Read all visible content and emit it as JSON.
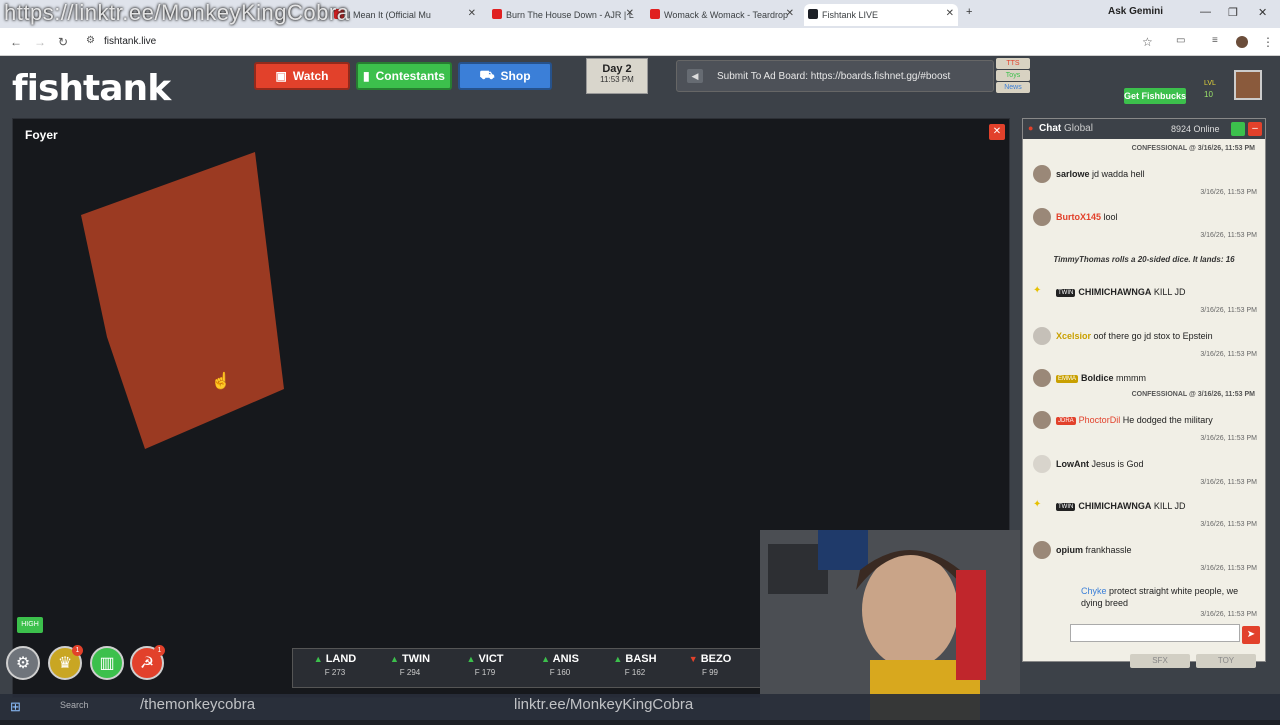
{
  "browser": {
    "watermark": "https://linktr.ee/MonkeyKingCobra",
    "tabs": [
      {
        "label": "I Mean It (Official Mu",
        "active": false
      },
      {
        "label": "Burn The House Down - AJR | L",
        "active": false
      },
      {
        "label": "Womack & Womack - Teardrop",
        "active": false
      },
      {
        "label": "Fishtank LIVE",
        "active": true
      }
    ],
    "ask_gemini": "Ask Gemini",
    "url": "fishtank.live"
  },
  "site": {
    "logo": "fishtank",
    "nav": {
      "watch": "Watch",
      "contestants": "Contestants",
      "shop": "Shop"
    },
    "day": {
      "label": "Day 2",
      "time": "11:53 PM"
    },
    "adboard": "Submit To Ad Board: https://boards.fishnet.gg/#boost",
    "side_tags": [
      "TTS",
      "Toys",
      "News"
    ],
    "user": {
      "fishbucks_label": "Get Fishbucks",
      "lvl": "LVL",
      "coins": "10"
    }
  },
  "video": {
    "room": "Foyer",
    "quality": "HIGH",
    "colors": {
      "block": "#9b3a22"
    }
  },
  "bottom": {
    "notification_badges": [
      "1",
      "1"
    ],
    "ticker": [
      {
        "name": "LAND",
        "value": "F 273",
        "dir": "up"
      },
      {
        "name": "TWIN",
        "value": "F 294",
        "dir": "up"
      },
      {
        "name": "VICT",
        "value": "F 179",
        "dir": "up"
      },
      {
        "name": "ANIS",
        "value": "F 160",
        "dir": "up"
      },
      {
        "name": "BASH",
        "value": "F 162",
        "dir": "up"
      },
      {
        "name": "BEZO",
        "value": "F 99",
        "dir": "down"
      }
    ]
  },
  "chat": {
    "title": "Chat",
    "scope": "Global",
    "online": "8924 Online",
    "messages": [
      {
        "kind": "confessional",
        "text": "CONFESSIONAL @ 3/16/26, 11:53 PM"
      },
      {
        "kind": "msg",
        "user": "sarlowe",
        "text": "jd wadda hell",
        "ts": "3/16/26, 11:53 PM",
        "color": "#222222"
      },
      {
        "kind": "msg",
        "user": "BurtoX145",
        "text": "lool",
        "ts": "3/16/26, 11:53 PM",
        "color": "#e2412b"
      },
      {
        "kind": "sys",
        "text": "TimmyThomas rolls a 20-sided dice. It lands: 16"
      },
      {
        "kind": "msg",
        "user": "CHIMICHAWNGA",
        "tag": "TWIN",
        "text": "KILL JD",
        "ts": "3/16/26, 11:53 PM",
        "color": "#222222"
      },
      {
        "kind": "msg",
        "user": "Xcelsior",
        "text": "oof there go jd stox to Epstein",
        "ts": "3/16/26, 11:53 PM",
        "color": "#c9a000"
      },
      {
        "kind": "msg",
        "user": "Boldice",
        "tag": "EMMA",
        "text": "mmmm",
        "ts": "3/16/26, 11:53 PM",
        "color": "#222222"
      },
      {
        "kind": "confessional",
        "text": "CONFESSIONAL @ 3/16/26, 11:53 PM"
      },
      {
        "kind": "msg",
        "user": "PhoctorDil",
        "tag": "JDRA",
        "text": "He dodged the military",
        "ts": "3/16/26, 11:53 PM",
        "color": "#e2412b"
      },
      {
        "kind": "msg",
        "user": "LowAnt",
        "text": "Jesus is God",
        "ts": "3/16/26, 11:53 PM",
        "color": "#222222"
      },
      {
        "kind": "msg",
        "user": "CHIMICHAWNGA",
        "tag": "TWIN",
        "text": "KILL JD",
        "ts": "3/16/26, 11:53 PM",
        "color": "#222222"
      },
      {
        "kind": "msg",
        "user": "opium",
        "text": "frankhassle",
        "ts": "3/16/26, 11:53 PM",
        "color": "#222222"
      },
      {
        "kind": "msg",
        "user": "Chyke",
        "text": "protect straight white people, we dying breed",
        "ts": "3/16/26, 11:53 PM",
        "color": "#3b7fd8"
      }
    ],
    "sfx_label": "SFX",
    "toy_label": "TOY"
  },
  "taskbar": {
    "search": "Search",
    "left_text": "/themonkeycobra",
    "right_text": "linktr.ee/MonkeyKingCobra"
  }
}
